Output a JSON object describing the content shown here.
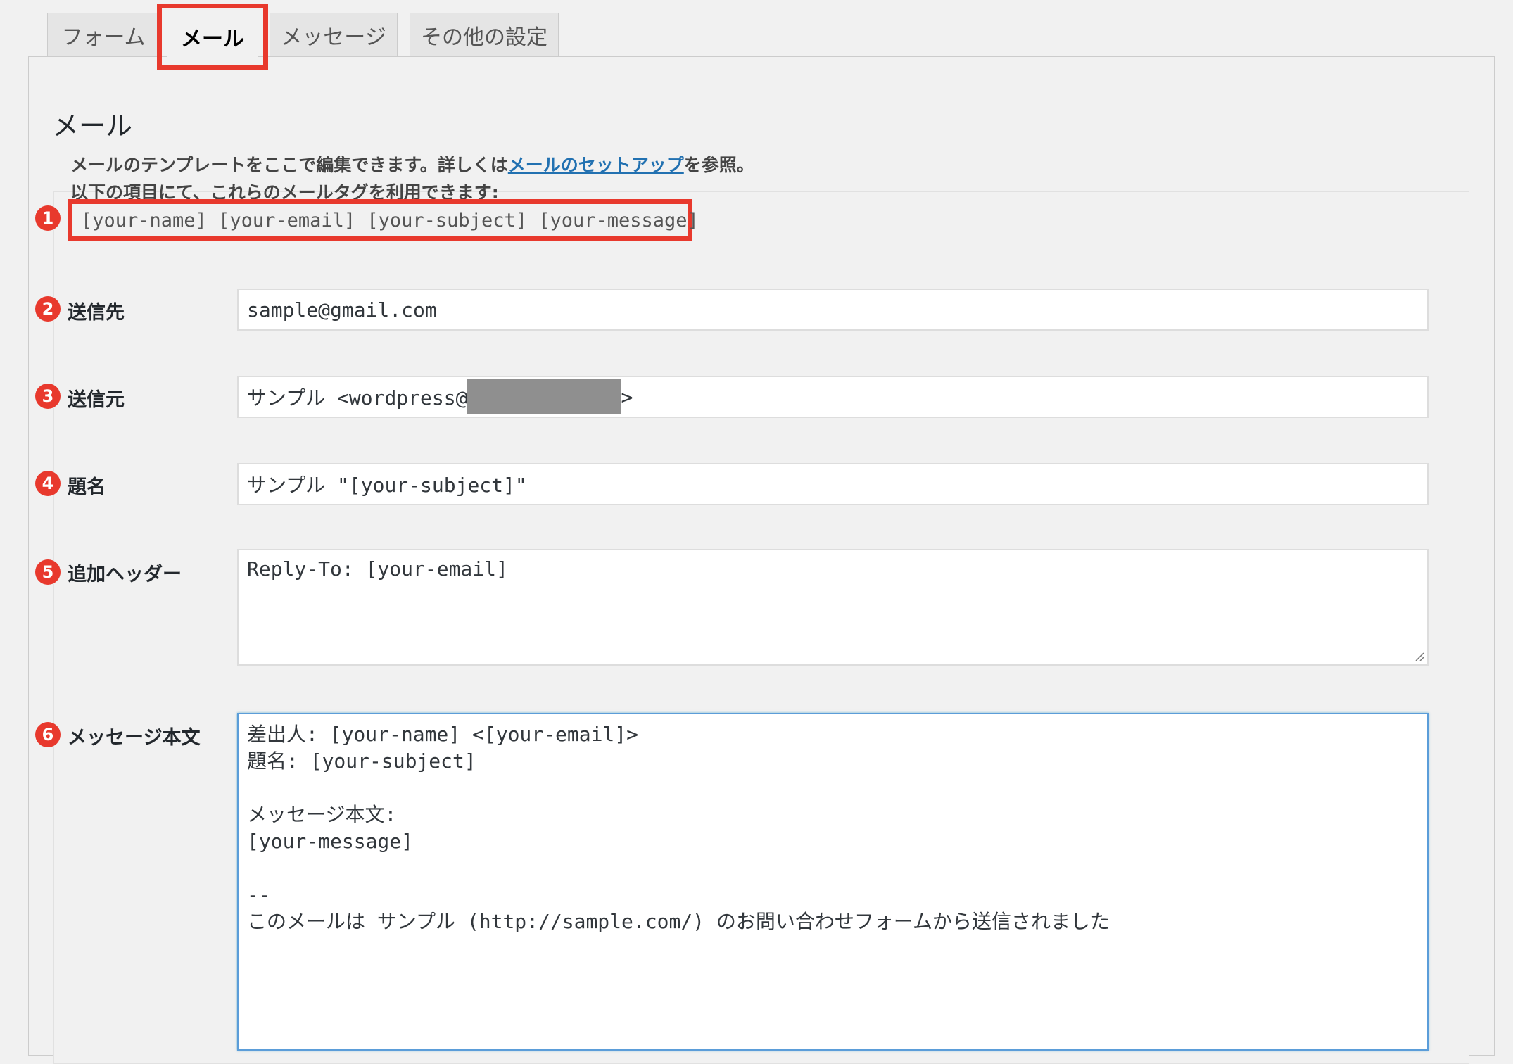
{
  "tabs": [
    {
      "label": "フォーム",
      "active": false
    },
    {
      "label": "メール",
      "active": true
    },
    {
      "label": "メッセージ",
      "active": false
    },
    {
      "label": "その他の設定",
      "active": false
    }
  ],
  "section": {
    "heading": "メール",
    "desc_line1_prefix": "メールのテンプレートをここで編集できます。詳しくは",
    "desc_link": "メールのセットアップ",
    "desc_line1_suffix": "を参照。",
    "desc_line2": "以下の項目にて、これらのメールタグを利用できます:",
    "mail_tags": "[your-name] [your-email] [your-subject] [your-message]"
  },
  "badges": [
    "1",
    "2",
    "3",
    "4",
    "5",
    "6"
  ],
  "fields": {
    "to": {
      "label": "送信先",
      "value": "sample@gmail.com"
    },
    "from": {
      "label": "送信元",
      "value_prefix": "サンプル <wordpress@",
      "value_suffix": ">"
    },
    "subject": {
      "label": "題名",
      "value": "サンプル \"[your-subject]\""
    },
    "headers": {
      "label": "追加ヘッダー",
      "value": "Reply-To: [your-email]"
    },
    "body": {
      "label": "メッセージ本文",
      "lines": [
        "差出人: [your-name] <[your-email]>",
        "題名: [your-subject]",
        "",
        "メッセージ本文:",
        "[your-message]",
        "",
        "--",
        "このメールは サンプル (http://sample.com/) のお問い合わせフォームから送信されました"
      ]
    }
  },
  "colors": {
    "highlight": "#e8392d",
    "link": "#2271b1",
    "focus": "#5b9dd9"
  }
}
